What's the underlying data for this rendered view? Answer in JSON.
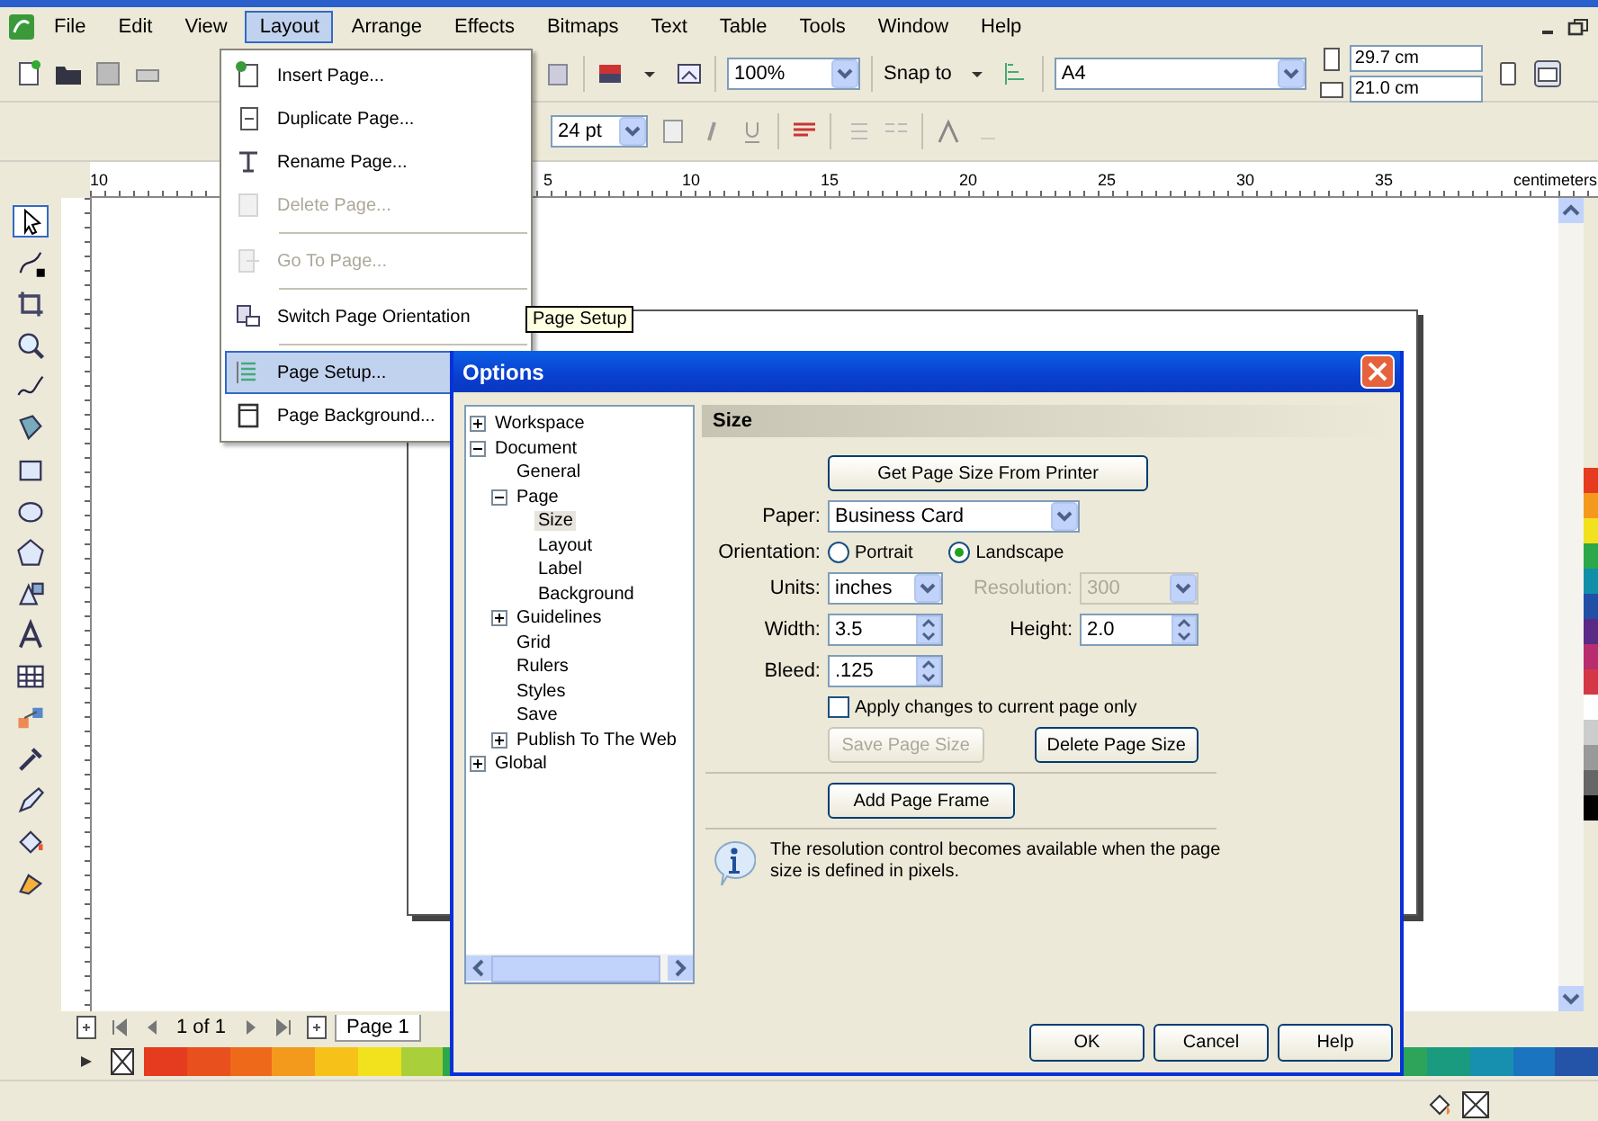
{
  "menubar": {
    "items": [
      {
        "label": "File",
        "selected": false
      },
      {
        "label": "Edit",
        "selected": false
      },
      {
        "label": "View",
        "selected": false
      },
      {
        "label": "Layout",
        "selected": true
      },
      {
        "label": "Arrange",
        "selected": false
      },
      {
        "label": "Effects",
        "selected": false
      },
      {
        "label": "Bitmaps",
        "selected": false
      },
      {
        "label": "Text",
        "selected": false
      },
      {
        "label": "Table",
        "selected": false
      },
      {
        "label": "Tools",
        "selected": false
      },
      {
        "label": "Window",
        "selected": false
      },
      {
        "label": "Help",
        "selected": false
      }
    ]
  },
  "toolbar": {
    "zoom": "100%",
    "snap": "Snap to",
    "paper": "A4",
    "page_width": "29.7 cm",
    "page_height": "21.0 cm"
  },
  "property_bar": {
    "font_size": "24 pt"
  },
  "ruler": {
    "labels": [
      "10",
      "5",
      "10",
      "15",
      "20",
      "25",
      "30",
      "35"
    ],
    "unit": "centimeters"
  },
  "layout_menu": {
    "items": [
      {
        "kind": "item",
        "label": "Insert Page...",
        "disabled": false,
        "selected": false
      },
      {
        "kind": "item",
        "label": "Duplicate Page...",
        "disabled": false,
        "selected": false
      },
      {
        "kind": "item",
        "label": "Rename Page...",
        "disabled": false,
        "selected": false
      },
      {
        "kind": "item",
        "label": "Delete Page...",
        "disabled": true,
        "selected": false
      },
      {
        "kind": "separator"
      },
      {
        "kind": "item",
        "label": "Go To Page...",
        "disabled": true,
        "selected": false
      },
      {
        "kind": "separator"
      },
      {
        "kind": "item",
        "label": "Switch Page Orientation",
        "disabled": false,
        "selected": false
      },
      {
        "kind": "separator"
      },
      {
        "kind": "item",
        "label": "Page Setup...",
        "disabled": false,
        "selected": true
      },
      {
        "kind": "item",
        "label": "Page Background...",
        "disabled": false,
        "selected": false
      }
    ]
  },
  "tooltip": "Page Setup",
  "options_dialog": {
    "title": "Options",
    "tree": [
      {
        "label": "Workspace",
        "expanded": false,
        "selected": false
      },
      {
        "label": "Document",
        "expanded": true,
        "selected": false,
        "children": [
          {
            "label": "General",
            "selected": false
          },
          {
            "label": "Page",
            "expanded": true,
            "selected": false,
            "children": [
              {
                "label": "Size",
                "selected": true
              },
              {
                "label": "Layout",
                "selected": false
              },
              {
                "label": "Label",
                "selected": false
              },
              {
                "label": "Background",
                "selected": false
              }
            ]
          },
          {
            "label": "Guidelines",
            "expanded": false,
            "selected": false
          },
          {
            "label": "Grid",
            "selected": false
          },
          {
            "label": "Rulers",
            "selected": false
          },
          {
            "label": "Styles",
            "selected": false
          },
          {
            "label": "Save",
            "selected": false
          },
          {
            "label": "Publish To The Web",
            "expanded": false,
            "selected": false
          }
        ]
      },
      {
        "label": "Global",
        "expanded": false,
        "selected": false
      }
    ],
    "section": "Size",
    "get_size_button": "Get Page Size From Printer",
    "paper": {
      "label": "Paper:",
      "value": "Business Card"
    },
    "orientation": {
      "label": "Orientation:",
      "options": [
        {
          "label": "Portrait",
          "selected": false
        },
        {
          "label": "Landscape",
          "selected": true
        }
      ]
    },
    "units": {
      "label": "Units:",
      "value": "inches"
    },
    "resolution": {
      "label": "Resolution:",
      "value": "300",
      "disabled": true
    },
    "width": {
      "label": "Width:",
      "value": "3.5"
    },
    "height": {
      "label": "Height:",
      "value": "2.0"
    },
    "bleed": {
      "label": "Bleed:",
      "value": ".125"
    },
    "apply_current": {
      "label": "Apply changes to current page only",
      "checked": false
    },
    "save_size_button": {
      "label": "Save Page Size",
      "disabled": true
    },
    "delete_size_button": {
      "label": "Delete Page Size",
      "disabled": false
    },
    "add_frame_button": "Add Page Frame",
    "info": "The resolution control becomes available when the page size is defined in pixels.",
    "buttons": [
      "OK",
      "Cancel",
      "Help"
    ]
  },
  "page_navigator": {
    "count": "1 of 1",
    "tabs": [
      {
        "label": "Page 1",
        "selected": true
      }
    ]
  }
}
